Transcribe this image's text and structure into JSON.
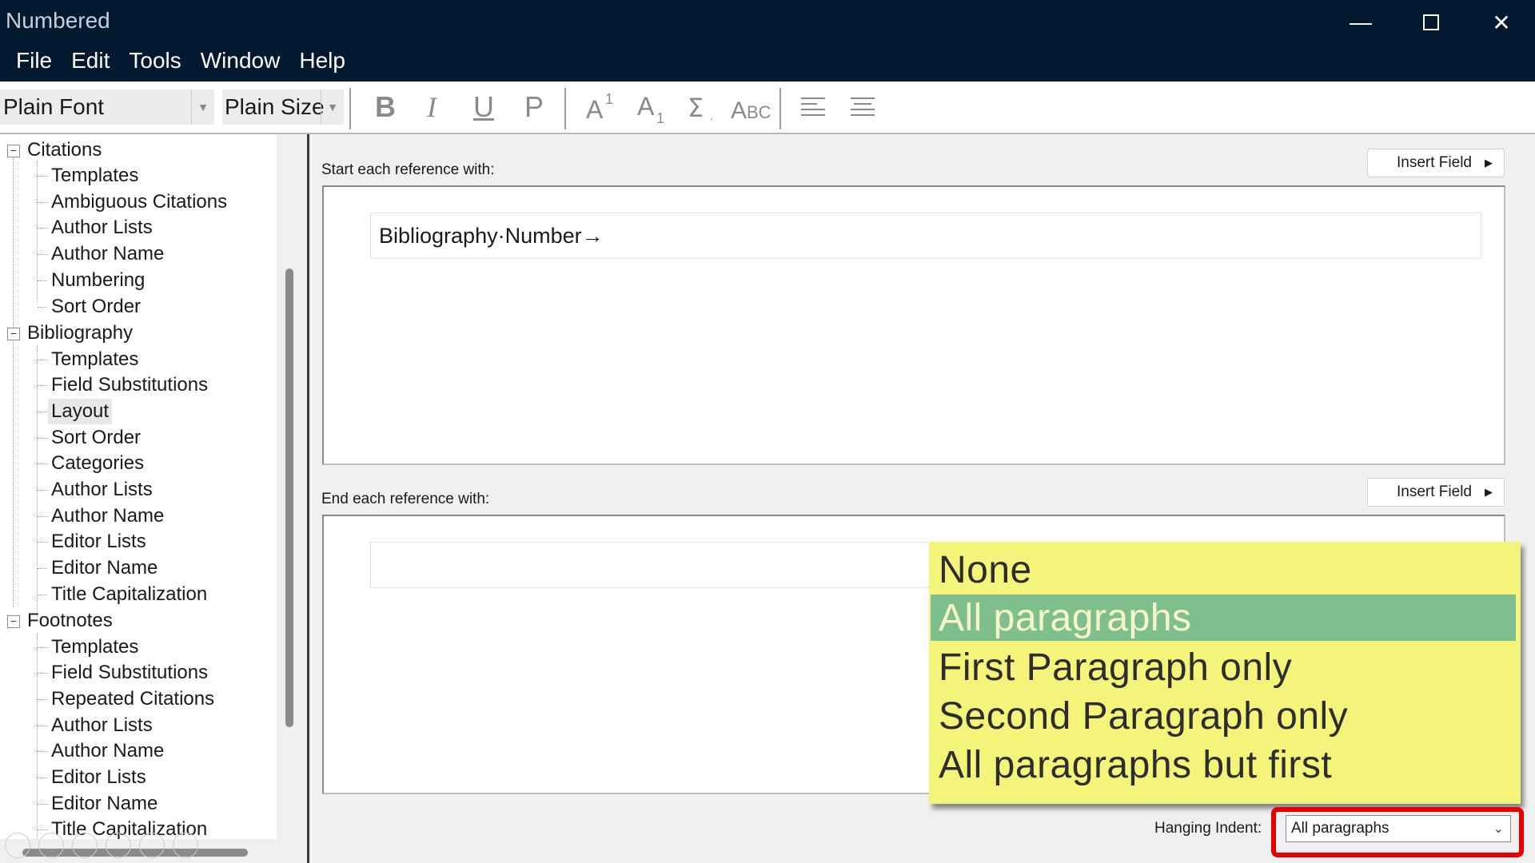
{
  "window": {
    "title": "Numbered"
  },
  "menu": [
    "File",
    "Edit",
    "Tools",
    "Window",
    "Help"
  ],
  "toolbar": {
    "font": "Plain Font",
    "size": "Plain Size",
    "bold": "B",
    "italic": "I",
    "underline": "U",
    "plain": "P"
  },
  "tree": {
    "groups": [
      {
        "label": "Citations",
        "items": [
          "Templates",
          "Ambiguous Citations",
          "Author Lists",
          "Author Name",
          "Numbering",
          "Sort Order"
        ]
      },
      {
        "label": "Bibliography",
        "items": [
          "Templates",
          "Field Substitutions",
          "Layout",
          "Sort Order",
          "Categories",
          "Author Lists",
          "Author Name",
          "Editor Lists",
          "Editor Name",
          "Title Capitalization"
        ]
      },
      {
        "label": "Footnotes",
        "items": [
          "Templates",
          "Field Substitutions",
          "Repeated Citations",
          "Author Lists",
          "Author Name",
          "Editor Lists",
          "Editor Name",
          "Title Capitalization"
        ]
      }
    ],
    "selected": "Layout"
  },
  "start_section": {
    "label": "Start each reference with:",
    "insert_field": "Insert Field",
    "content": "Bibliography·Number→"
  },
  "end_section": {
    "label": "End each reference with:",
    "insert_field": "Insert Field",
    "content": ""
  },
  "hanging_indent": {
    "label": "Hanging Indent:",
    "value": "All paragraphs",
    "options": [
      "None",
      "All paragraphs",
      "First Paragraph only",
      "Second Paragraph only",
      "All paragraphs but first"
    ],
    "selected_option": "All paragraphs"
  },
  "colors": {
    "titlebar": "#02192f",
    "dropdown_bg": "#f4f47a",
    "dropdown_selected": "#7fbf8e",
    "highlight": "#e40000"
  }
}
